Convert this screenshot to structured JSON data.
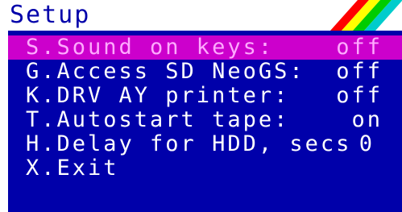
{
  "title": "Setup",
  "colors": {
    "panel": "#0000aa",
    "selected": "#cc00cc",
    "selected_text": "#ffaaff",
    "text": "#ffffff",
    "stripes": [
      "#ff0000",
      "#ffff00",
      "#00cc00",
      "#00cccc"
    ]
  },
  "items": [
    {
      "label": "S.Sound on keys:",
      "value": "off",
      "selected": true
    },
    {
      "label": "G.Access SD NeoGS:",
      "value": "off",
      "selected": false
    },
    {
      "label": "K.DRV AY printer:",
      "value": "off",
      "selected": false
    },
    {
      "label": "T.Autostart tape:",
      "value": "on",
      "selected": false
    },
    {
      "label": "H.Delay for HDD, secs",
      "value": "0",
      "selected": false
    },
    {
      "label": "X.Exit",
      "value": "",
      "selected": false
    }
  ]
}
